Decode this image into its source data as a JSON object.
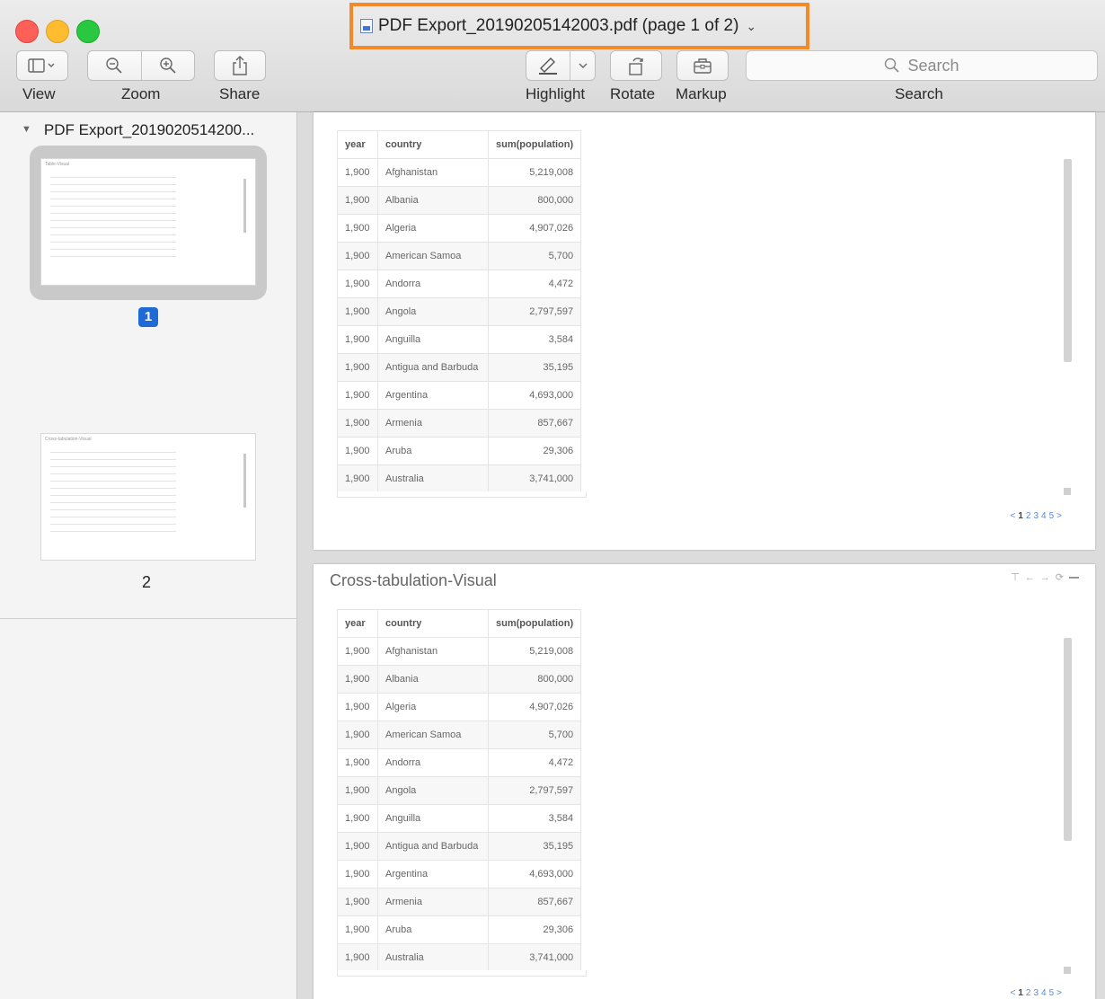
{
  "window": {
    "title": "PDF Export_20190205142003.pdf (page 1 of 2)"
  },
  "toolbar": {
    "view_label": "View",
    "zoom_label": "Zoom",
    "share_label": "Share",
    "highlight_label": "Highlight",
    "rotate_label": "Rotate",
    "markup_label": "Markup",
    "search_label": "Search",
    "search_placeholder": "Search"
  },
  "sidebar": {
    "document_name": "PDF Export_2019020514200...",
    "thumbnails": [
      {
        "page": "1",
        "title": "Table-Visual"
      },
      {
        "page": "2",
        "title": "Cross-tabulation-Visual"
      }
    ]
  },
  "pages": [
    {
      "title": "",
      "columns": [
        "year",
        "country",
        "sum(population)"
      ],
      "rows": [
        [
          "1,900",
          "Afghanistan",
          "5,219,008"
        ],
        [
          "1,900",
          "Albania",
          "800,000"
        ],
        [
          "1,900",
          "Algeria",
          "4,907,026"
        ],
        [
          "1,900",
          "American Samoa",
          "5,700"
        ],
        [
          "1,900",
          "Andorra",
          "4,472"
        ],
        [
          "1,900",
          "Angola",
          "2,797,597"
        ],
        [
          "1,900",
          "Anguilla",
          "3,584"
        ],
        [
          "1,900",
          "Antigua and Barbuda",
          "35,195"
        ],
        [
          "1,900",
          "Argentina",
          "4,693,000"
        ],
        [
          "1,900",
          "Armenia",
          "857,667"
        ],
        [
          "1,900",
          "Aruba",
          "29,306"
        ],
        [
          "1,900",
          "Australia",
          "3,741,000"
        ]
      ],
      "pagination": [
        "<",
        "1",
        "2",
        "3",
        "4",
        "5",
        ">"
      ]
    },
    {
      "title": "Cross-tabulation-Visual",
      "columns": [
        "year",
        "country",
        "sum(population)"
      ],
      "rows": [
        [
          "1,900",
          "Afghanistan",
          "5,219,008"
        ],
        [
          "1,900",
          "Albania",
          "800,000"
        ],
        [
          "1,900",
          "Algeria",
          "4,907,026"
        ],
        [
          "1,900",
          "American Samoa",
          "5,700"
        ],
        [
          "1,900",
          "Andorra",
          "4,472"
        ],
        [
          "1,900",
          "Angola",
          "2,797,597"
        ],
        [
          "1,900",
          "Anguilla",
          "3,584"
        ],
        [
          "1,900",
          "Antigua and Barbuda",
          "35,195"
        ],
        [
          "1,900",
          "Argentina",
          "4,693,000"
        ],
        [
          "1,900",
          "Armenia",
          "857,667"
        ],
        [
          "1,900",
          "Aruba",
          "29,306"
        ],
        [
          "1,900",
          "Australia",
          "3,741,000"
        ]
      ],
      "pagination": [
        "<",
        "1",
        "2",
        "3",
        "4",
        "5",
        ">"
      ]
    }
  ],
  "colors": {
    "title_highlight": "#f28a2a",
    "selected_badge": "#1f6bd6",
    "pager_link": "#5a8ad0"
  }
}
